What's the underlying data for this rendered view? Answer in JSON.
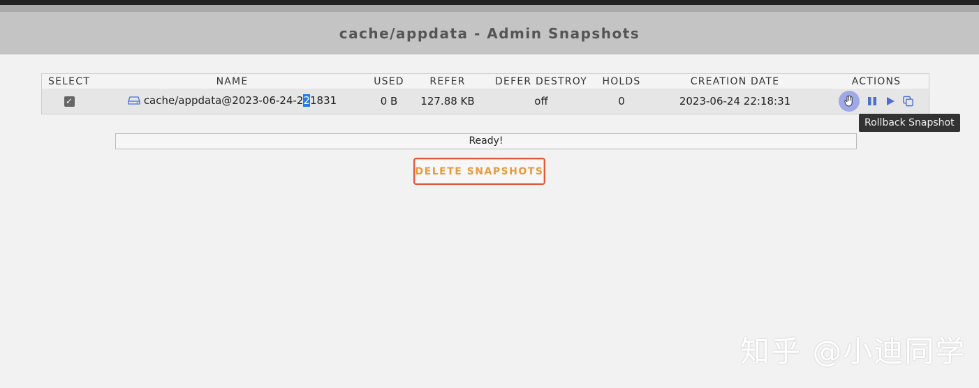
{
  "page_title": "cache/appdata - Admin Snapshots",
  "table": {
    "headers": [
      "SELECT",
      "NAME",
      "USED",
      "REFER",
      "DEFER DESTROY",
      "HOLDS",
      "CREATION DATE",
      "ACTIONS"
    ],
    "rows": [
      {
        "selected": true,
        "name_before": "cache/appdata@2023-06-24-2",
        "name_highlight": "2",
        "name_after": "1831",
        "used": "0 B",
        "refer": "127.88 KB",
        "defer_destroy": "off",
        "holds": "0",
        "creation_date": "2023-06-24 22:18:31"
      }
    ]
  },
  "tooltip": "Rollback Snapshot",
  "status_text": "Ready!",
  "delete_button_label": "DELETE SNAPSHOTS",
  "watermark": "知乎 @小迪同学",
  "icons": {
    "checkbox": "checkbox-checked-icon",
    "dataset": "drive-icon",
    "rollback": "rollback-icon",
    "hold": "pause-icon",
    "send": "play-icon",
    "clone": "copy-icon"
  },
  "colors": {
    "accent_blue": "#4a6fd1",
    "delete_border": "#e0583a",
    "delete_text": "#e89a3c"
  }
}
